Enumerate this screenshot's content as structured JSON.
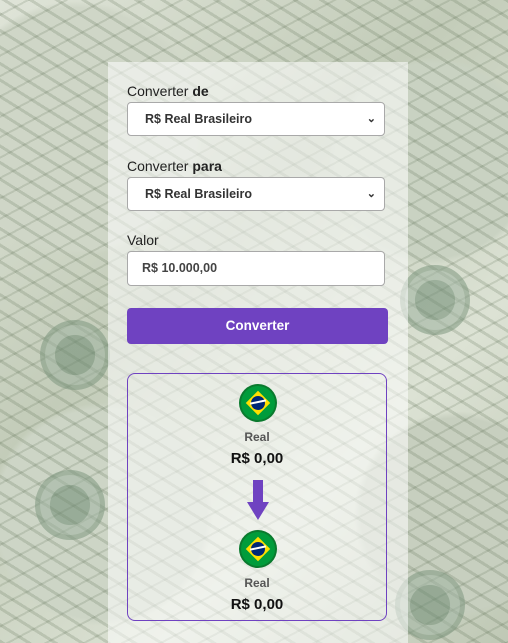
{
  "form": {
    "from_label_prefix": "Converter",
    "from_label_strong": "de",
    "from_value": "R$ Real Brasileiro",
    "to_label_prefix": "Converter",
    "to_label_strong": "para",
    "to_value": "R$ Real Brasileiro",
    "amount_label": "Valor",
    "amount_placeholder": "R$ 10.000,00",
    "submit_label": "Converter"
  },
  "result": {
    "from": {
      "currency_name": "Real",
      "value": "R$ 0,00",
      "flag_icon": "brazil-flag-icon"
    },
    "to": {
      "currency_name": "Real",
      "value": "R$ 0,00",
      "flag_icon": "brazil-flag-icon"
    },
    "arrow_icon": "arrow-down-icon"
  },
  "colors": {
    "accent": "#6f42c1"
  }
}
